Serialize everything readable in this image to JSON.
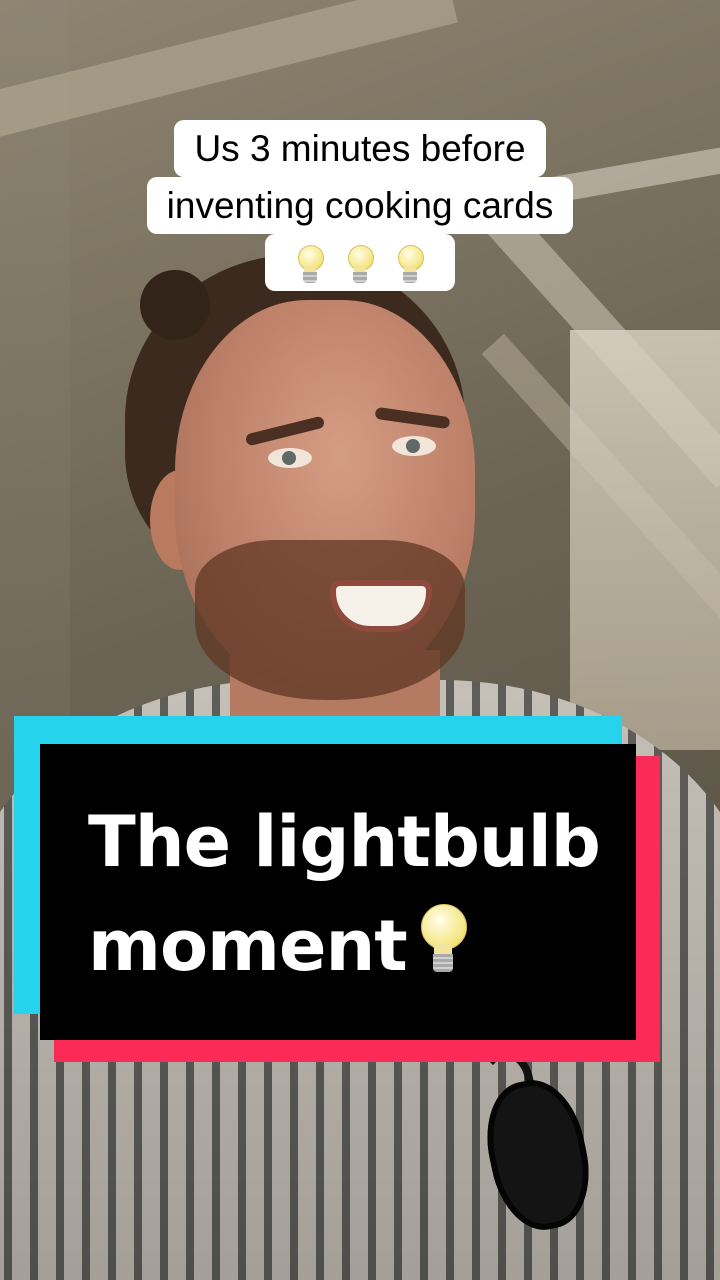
{
  "video": {
    "caption": {
      "line1": "Us 3 minutes before",
      "line2": "inventing cooking cards",
      "emoji": [
        "lightbulb-icon",
        "lightbulb-icon",
        "lightbulb-icon"
      ]
    },
    "title_card": {
      "line1": "The lightbulb",
      "line2": "moment",
      "emoji": "lightbulb-icon",
      "colors": {
        "card": "#000000",
        "accent_cyan": "#25d4ec",
        "accent_red": "#fb2b57",
        "text": "#ffffff"
      }
    }
  }
}
